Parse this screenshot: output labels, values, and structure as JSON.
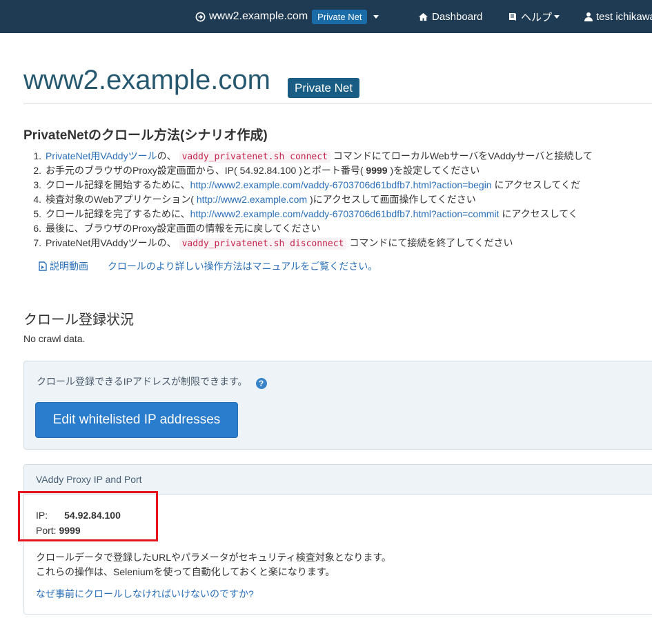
{
  "colors": {
    "navbar_bg": "#1f3a53",
    "badge_bg": "#1a5d84",
    "link": "#2a6fb8",
    "primary_button": "#2a7ccc",
    "code_text": "#c7254e",
    "highlight_border": "#e3121b"
  },
  "navbar": {
    "site_icon": "arrow-circle-right-icon",
    "site": "www2.example.com",
    "badge": "Private Net",
    "dashboard_icon": "home-icon",
    "dashboard": "Dashboard",
    "help_icon": "book-icon",
    "help": "ヘルプ",
    "user_icon": "user-icon",
    "user": "test ichikawa"
  },
  "header": {
    "title": "www2.example.com",
    "badge": "Private Net"
  },
  "crawl_method": {
    "heading": "PrivateNetのクロール方法(シナリオ作成)",
    "step1": {
      "num": "1.",
      "link": "PrivateNet用VAddyツール",
      "pre": "の、",
      "code": "vaddy_privatenet.sh connect",
      "post": "コマンドにてローカルWebサーバをVAddyサーバと接続して"
    },
    "step2": {
      "num": "2.",
      "pre": "お手元のブラウザのProxy設定画面から、IP( 54.92.84.100 )とポート番号( ",
      "bold": "9999",
      "post": " )を設定してください"
    },
    "step3": {
      "num": "3.",
      "pre": "クロール記録を開始するために、",
      "link": "http://www2.example.com/vaddy-6703706d61bdfb7.html?action=begin",
      "post": " にアクセスしてくだ"
    },
    "step4": {
      "num": "4.",
      "pre": "検査対象のWebアプリケーション( ",
      "link": "http://www2.example.com",
      "post": " )にアクセスして画面操作してください"
    },
    "step5": {
      "num": "5.",
      "pre": "クロール記録を完了するために、",
      "link": "http://www2.example.com/vaddy-6703706d61bdfb7.html?action=commit",
      "post": " にアクセスしてく"
    },
    "step6": {
      "num": "6.",
      "text": "最後に、ブラウザのProxy設定画面の情報を元に戻してください"
    },
    "step7": {
      "num": "7.",
      "pre": "PrivateNet用VAddyツールの、",
      "code": "vaddy_privatenet.sh disconnect",
      "post": "コマンドにて接続を終了してください"
    },
    "video_icon": "file-video-icon",
    "video_link": "説明動画",
    "manual_link": "クロールのより詳しい操作方法はマニュアルをご覧ください。"
  },
  "crawl_status": {
    "heading": "クロール登録状況",
    "empty": "No crawl data."
  },
  "whitelist": {
    "text": "クロール登録できるIPアドレスが制限できます。",
    "help_icon": "question-circle-icon",
    "help_glyph": "?",
    "button": "Edit whitelisted IP addresses"
  },
  "proxy": {
    "title": "VAddy Proxy IP and Port",
    "ip_label": "IP:",
    "ip": "54.92.84.100",
    "port_label": "Port:",
    "port": "9999",
    "desc1": "クロールデータで登録したURLやパラメータがセキュリティ検査対象となります。",
    "desc2": "これらの操作は、Seleniumを使って自動化しておくと楽になります。",
    "why_link": "なぜ事前にクロールしなければいけないのですか?"
  }
}
